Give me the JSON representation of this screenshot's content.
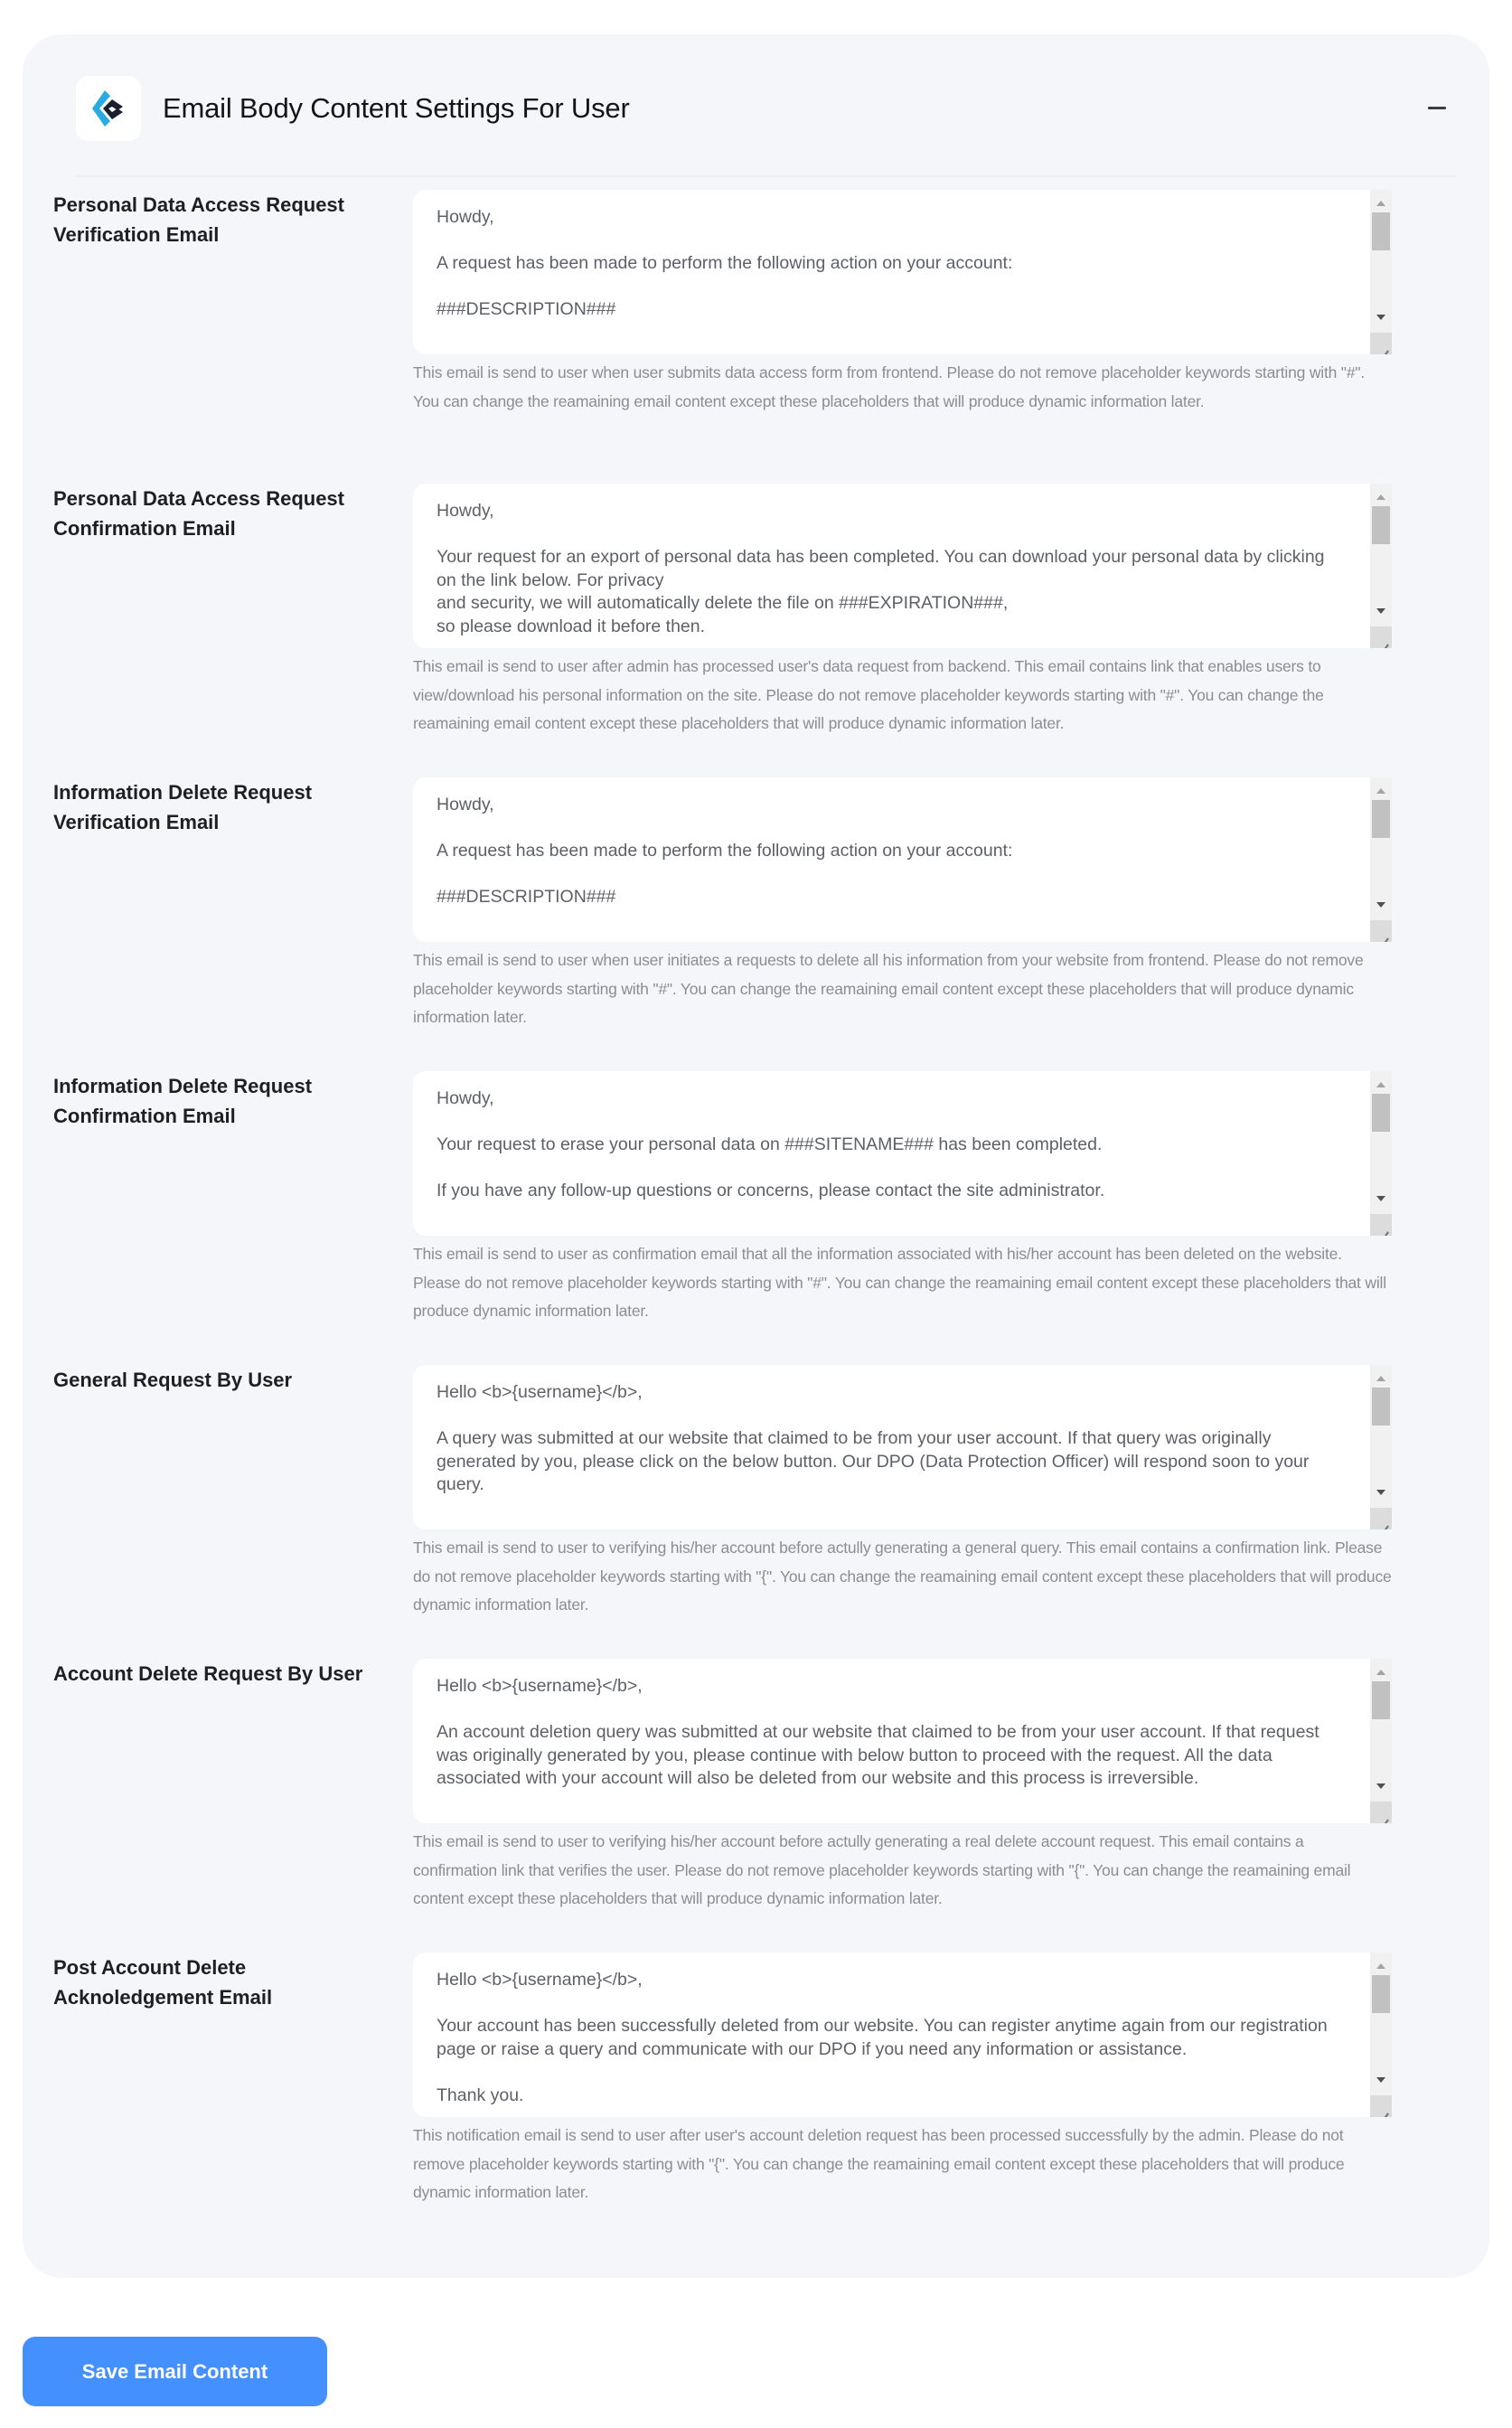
{
  "header": {
    "title": "Email Body Content Settings For User",
    "logo_icon": "brand-logo-chevron-icon",
    "collapse_icon": "minus-icon"
  },
  "colors": {
    "accent": "#4590ff",
    "logo_blue": "#29abe2",
    "logo_dark": "#1a1f2e",
    "card_bg": "#f5f6fa",
    "help_text": "#8a8d94"
  },
  "sections": [
    {
      "label": "Personal Data Access Request Verification Email",
      "body": "Howdy,\n\nA request has been made to perform the following action on your account:\n\n###DESCRIPTION###",
      "help": "This email is send to user when user submits data access form from frontend. Please do not remove placeholder keywords starting with \"#\". You can change the reamaining email content except these placeholders that will produce dynamic information later."
    },
    {
      "label": "Personal Data Access Request Confirmation Email",
      "body": "Howdy,\n\nYour request for an export of personal data has been completed. You can download your personal data by clicking on the link below. For privacy\nand security, we will automatically delete the file on ###EXPIRATION###,\nso please download it before then.",
      "help": "This email is send to user after admin has processed user's data request from backend. This email contains link that enables users to view/download his personal information on the site. Please do not remove placeholder keywords starting with \"#\". You can change the reamaining email content except these placeholders that will produce dynamic information later."
    },
    {
      "label": "Information Delete Request Verification Email",
      "body": "Howdy,\n\nA request has been made to perform the following action on your account:\n\n###DESCRIPTION###",
      "help": "This email is send to user when user initiates a requests to delete all his information from your website from frontend. Please do not remove placeholder keywords starting with \"#\". You can change the reamaining email content except these placeholders that will produce dynamic information later."
    },
    {
      "label": "Information Delete Request Confirmation Email",
      "body": "Howdy,\n\nYour request to erase your personal data on ###SITENAME### has been completed.\n\nIf you have any follow-up questions or concerns, please contact the site administrator.",
      "help": "This email is send to user as confirmation email that all the information associated with his/her account has been deleted on the website. Please do not remove placeholder keywords starting with \"#\". You can change the reamaining email content except these placeholders that will produce dynamic information later."
    },
    {
      "label": "General Request By User",
      "body": "Hello <b>{username}</b>,\n\nA query was submitted at our website that claimed to be from your user account. If that query was originally generated by you, please click on the below button. Our DPO (Data Protection Officer) will respond soon to your query.",
      "help": "This email is send to user to verifying his/her account before actully generating a general query. This email contains a confirmation link. Please do not remove placeholder keywords starting with \"{\". You can change the reamaining email content except these placeholders that will produce dynamic information later."
    },
    {
      "label": "Account Delete Request By User",
      "body": "Hello <b>{username}</b>,\n\nAn account deletion query was submitted at our website that claimed to be from your user account. If that request was originally generated by you, please continue with below button to proceed with the request. All the data associated with your account will also be deleted from our website and this process is irreversible.",
      "help": "This email is send to user to verifying his/her account before actully generating a real delete account request. This email contains a confirmation link that verifies the user. Please do not remove placeholder keywords starting with \"{\". You can change the reamaining email content except these placeholders that will produce dynamic information later."
    },
    {
      "label": "Post Account Delete Acknoledgement Email",
      "body": "Hello <b>{username}</b>,\n\nYour account has been successfully deleted from our website. You can register anytime again from our registration page or raise a query and communicate with our DPO if you need any information or assistance.\n\nThank you.",
      "help": "This notification email is send to user after user's account deletion request has been processed successfully by the admin. Please do not remove placeholder keywords starting with \"{\". You can change the reamaining email content except these placeholders that will produce dynamic information later."
    }
  ],
  "actions": {
    "save_label": "Save Email Content"
  }
}
